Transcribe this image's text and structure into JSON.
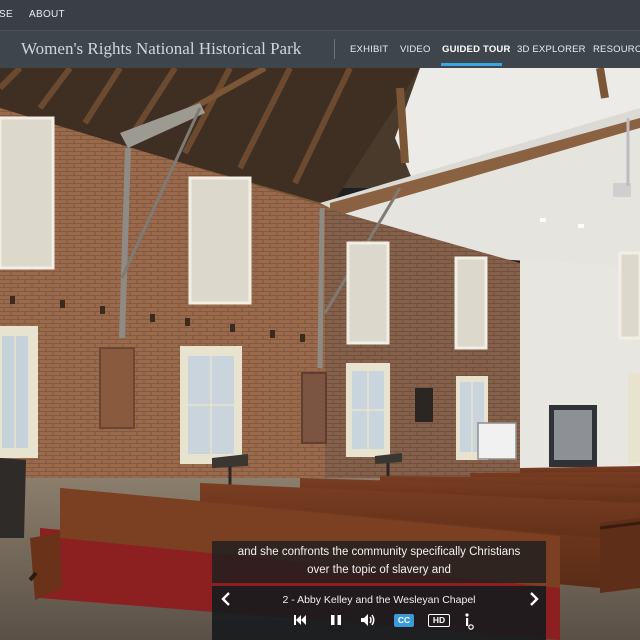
{
  "topbar": {
    "links": [
      "SE",
      "ABOUT"
    ]
  },
  "header": {
    "park_title": "Women's Rights National Historical Park",
    "nav": [
      "EXHIBIT",
      "VIDEO",
      "GUIDED TOUR",
      "3D EXPLORER",
      "RESOURCE"
    ],
    "active_nav": "GUIDED TOUR",
    "accent_color": "#38a7e4"
  },
  "caption": {
    "line1": "and she confronts the community specifically  Christians",
    "line2": "over the topic of slavery and"
  },
  "player": {
    "stop_title": "2 - Abby Kelley and the Wesleyan Chapel",
    "prev_icon": "chevron-left-icon",
    "next_icon": "chevron-right-icon",
    "cc_label": "CC",
    "hd_label": "HD",
    "buttons": [
      "skip-back-icon",
      "pause-icon",
      "volume-icon",
      "cc-icon",
      "hd-icon",
      "info-icon"
    ]
  }
}
